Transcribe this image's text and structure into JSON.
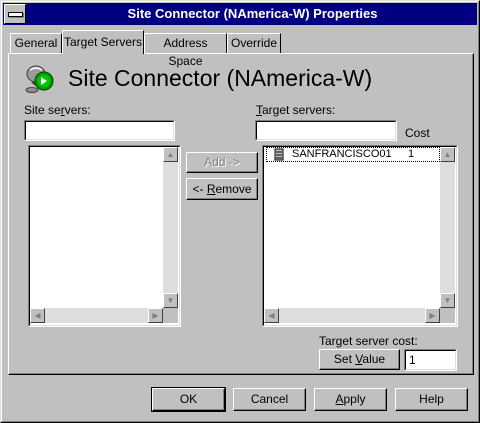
{
  "window": {
    "title": "Site Connector (NAmerica-W) Properties"
  },
  "tabs": [
    {
      "label": "General",
      "selected": false
    },
    {
      "label": "Target Servers",
      "selected": true
    },
    {
      "label": "Address Space",
      "selected": false
    },
    {
      "label": "Override",
      "selected": false
    }
  ],
  "header": {
    "icon": "site-connector-icon",
    "title": "Site Connector (NAmerica-W)"
  },
  "site_servers": {
    "label_prefix": "Site se",
    "label_accel": "r",
    "label_suffix": "vers:",
    "filter_value": "",
    "items": []
  },
  "target_servers": {
    "label_accel": "T",
    "label_suffix": "arget servers:",
    "filter_value": "",
    "cost_header": "Cost",
    "items": [
      {
        "icon": "server-icon",
        "name": "SANFRANCISCO01",
        "cost": "1"
      }
    ]
  },
  "buttons": {
    "add": "Add ->",
    "remove_prefix": "<- ",
    "remove_accel": "R",
    "remove_suffix": "emove",
    "set_value_prefix": "Set ",
    "set_value_accel": "V",
    "set_value_suffix": "alue"
  },
  "target_server_cost": {
    "label": "Target server cost:",
    "value": "1"
  },
  "footer": {
    "ok": "OK",
    "cancel": "Cancel",
    "apply_accel": "A",
    "apply_suffix": "pply",
    "help": "Help"
  },
  "colors": {
    "titlebar": "#000080",
    "face": "#c0c0c0"
  }
}
